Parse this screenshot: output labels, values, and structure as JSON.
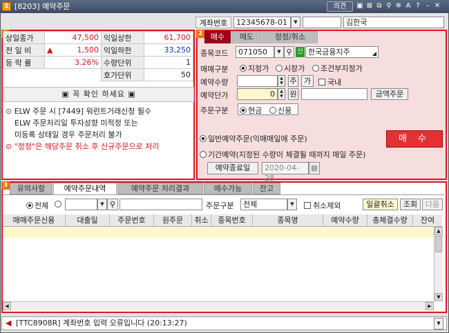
{
  "window": {
    "badge": "1",
    "title": "[8203] 예약주문",
    "link_label": "의견"
  },
  "account": {
    "label": "계좌번호",
    "number": "12345678-01",
    "owner": "김한국"
  },
  "section_badges": {
    "s1": "1",
    "s2": "2",
    "s3": "3"
  },
  "quote": {
    "rows": [
      {
        "label": "상일종가",
        "value": "47,500",
        "label2": "익일상한",
        "value2": "61,700"
      },
      {
        "label": "전 일 비",
        "value": "1,500",
        "label2": "익일하한",
        "value2": "33,250"
      },
      {
        "label": "등 락 률",
        "value": "3.26%",
        "label2": "수량단위",
        "value2": "1"
      },
      {
        "label": "",
        "value": "",
        "label2": "호가단위",
        "value2": "50"
      }
    ]
  },
  "notice": {
    "header": "꼭 확인 하세요",
    "lines": [
      "ELW 주문 시 [7449] 워런트거래신청 필수",
      "ELW 주문처리일 투자성향 미적정 또는",
      "미등록 상태일 경우 주문처리 불가",
      "\"정정\"은 해당주문 취소 후 신규주문으로 처리"
    ]
  },
  "order_tabs": [
    "매수",
    "매도",
    "정정/취소"
  ],
  "order": {
    "code_label": "종목코드",
    "code": "071050",
    "credit_badge": "신",
    "stock_name": "한국금융지주",
    "type_label": "매매구분",
    "types": [
      "지정가",
      "시장가",
      "조건부지정가"
    ],
    "qty_label": "예약수량",
    "qty_unit": "주",
    "qty_btn": "가",
    "domestic": "국내",
    "price_label": "예약단가",
    "price": "0",
    "price_unit": "원",
    "amount_btn": "금액주문",
    "kind_label": "주문구분",
    "kinds": [
      "현금",
      "신용"
    ],
    "mode1": "일반예약주문(익매매일에 주문)",
    "mode2": "기간예약(지정된 수량이 체결될 때까지 매일 주문)",
    "end_date_label": "예약종료일",
    "end_date": "2020-04-28",
    "buy_label": "매 수"
  },
  "bottom_tabs": [
    "유의사항",
    "예약주문내역",
    "예약주문 처리결과",
    "매수가능",
    "잔고"
  ],
  "filter": {
    "all": "전체",
    "order_type_label": "주문구분",
    "order_type": "전체",
    "exclude_cancel": "취소제외",
    "batch_cancel": "일괄취소",
    "search": "조회",
    "next": "다음"
  },
  "columns": [
    "매매주문신용",
    "대출일",
    "주문번호",
    "원주문",
    "취소",
    "종목번호",
    "종목명",
    "예약수량",
    "총체결수량",
    "잔여"
  ],
  "status": {
    "message": "[TTC8908R] 계좌번호 입력 오류입니다 (20:13:27)"
  }
}
